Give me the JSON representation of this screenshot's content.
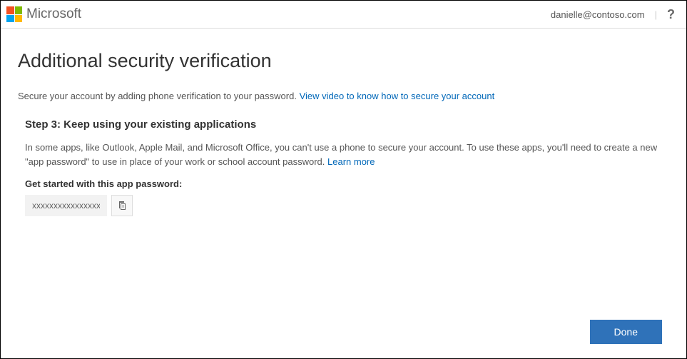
{
  "header": {
    "brand": "Microsoft",
    "user_email": "danielle@contoso.com",
    "help_label": "?"
  },
  "page": {
    "title": "Additional security verification",
    "subtitle_text": "Secure your account by adding phone verification to your password. ",
    "subtitle_link": "View video to know how to secure your account",
    "step_title": "Step 3: Keep using your existing applications",
    "step_desc_text": "In some apps, like Outlook, Apple Mail, and Microsoft Office, you can't use a phone to secure your account. To use these apps, you'll need to create a new \"app password\" to use in place of your work or school account password. ",
    "step_desc_link": "Learn more",
    "password_label": "Get started with this app password:",
    "password_value": "xxxxxxxxxxxxxxxx",
    "done_label": "Done"
  }
}
